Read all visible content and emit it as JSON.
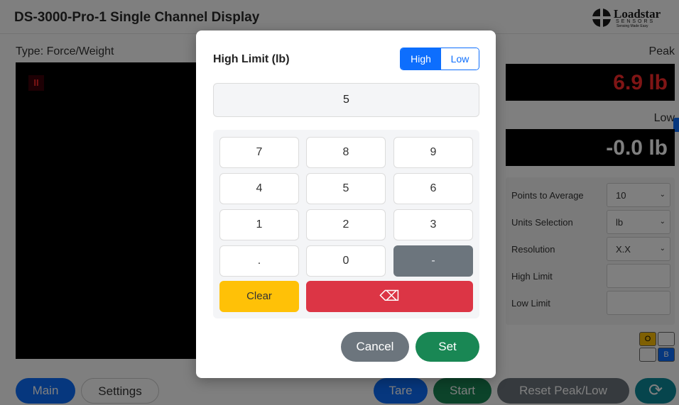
{
  "header": {
    "title": "DS-3000-Pro-1 Single Channel Display",
    "logo_brand": "Loadstar",
    "logo_sub": "SENSORS",
    "logo_tagline": "Sensing Made Easy"
  },
  "main": {
    "type_label": "Type: Force/Weight",
    "pause_glyph": "II",
    "peak_label": "Peak",
    "peak_value": "6.9 lb",
    "low_label": "Low",
    "low_value": "-0.0 lb",
    "settings": [
      {
        "label": "Points to Average",
        "value": "10"
      },
      {
        "label": "Units Selection",
        "value": "lb"
      },
      {
        "label": "Resolution",
        "value": "X.X"
      },
      {
        "label": "High Limit",
        "value": ""
      },
      {
        "label": "Low Limit",
        "value": ""
      }
    ],
    "ob": {
      "o": "O",
      "b": "B"
    }
  },
  "bottom_bar": {
    "main": "Main",
    "settings": "Settings",
    "tare": "Tare",
    "start": "Start",
    "reset": "Reset Peak/Low",
    "refresh_glyph": "⟳"
  },
  "modal": {
    "title": "High Limit (lb)",
    "toggle_high": "High",
    "toggle_low": "Low",
    "display_value": "5",
    "keys": [
      "7",
      "8",
      "9",
      "4",
      "5",
      "6",
      "1",
      "2",
      "3",
      ".",
      "0",
      "-"
    ],
    "clear": "Clear",
    "backspace_glyph": "⌫",
    "cancel": "Cancel",
    "set": "Set"
  },
  "colors": {
    "primary": "#0d6efd",
    "success": "#198754",
    "danger": "#dc3545",
    "warning": "#ffc107",
    "secondary": "#6c757d"
  }
}
